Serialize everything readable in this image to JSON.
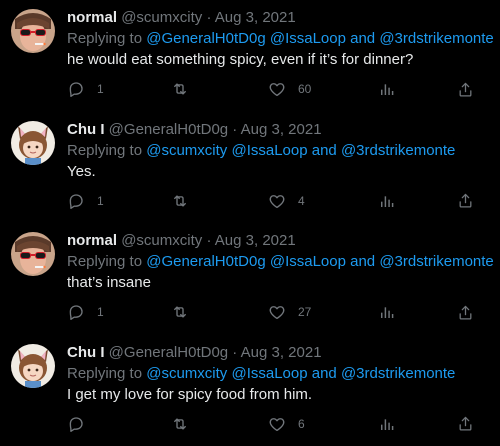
{
  "tweets": [
    {
      "avatar": "sunglasses-avatar",
      "name": "normal",
      "handle": "@scumxcity",
      "dot": "·",
      "date": "Aug 3, 2021",
      "replying_prefix": "Replying to",
      "mentions": [
        "@GeneralH0tD0g",
        "@IssaLoop",
        "@3rdstrikemonte"
      ],
      "and_word": "and",
      "text": "he would eat something spicy, even if it’s for dinner?",
      "reply_count": "1",
      "retweet_count": "",
      "like_count": "60"
    },
    {
      "avatar": "cat-ears-avatar",
      "name": "Chu I",
      "handle": "@GeneralH0tD0g",
      "dot": "·",
      "date": "Aug 3, 2021",
      "replying_prefix": "Replying to",
      "mentions": [
        "@scumxcity",
        "@IssaLoop",
        "@3rdstrikemonte"
      ],
      "and_word": "and",
      "text": "Yes.",
      "reply_count": "1",
      "retweet_count": "",
      "like_count": "4"
    },
    {
      "avatar": "sunglasses-avatar",
      "name": "normal",
      "handle": "@scumxcity",
      "dot": "·",
      "date": "Aug 3, 2021",
      "replying_prefix": "Replying to",
      "mentions": [
        "@GeneralH0tD0g",
        "@IssaLoop",
        "@3rdstrikemonte"
      ],
      "and_word": "and",
      "text": "that’s insane",
      "reply_count": "1",
      "retweet_count": "",
      "like_count": "27"
    },
    {
      "avatar": "cat-ears-avatar",
      "name": "Chu I",
      "handle": "@GeneralH0tD0g",
      "dot": "·",
      "date": "Aug 3, 2021",
      "replying_prefix": "Replying to",
      "mentions": [
        "@scumxcity",
        "@IssaLoop",
        "@3rdstrikemonte"
      ],
      "and_word": "and",
      "text": "I get my love for spicy food from him.",
      "reply_count": "",
      "retweet_count": "",
      "like_count": "6"
    }
  ],
  "colors": {
    "background": "#000000",
    "text": "#e7e9ea",
    "secondary": "#71767b",
    "link": "#1d9bf0"
  },
  "icons": [
    "reply-icon",
    "retweet-icon",
    "like-icon",
    "analytics-icon",
    "share-icon"
  ]
}
